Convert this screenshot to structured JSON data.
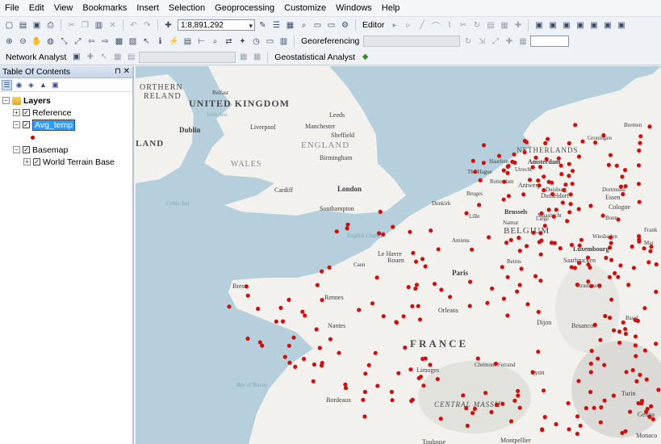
{
  "menu": [
    "File",
    "Edit",
    "View",
    "Bookmarks",
    "Insert",
    "Selection",
    "Geoprocessing",
    "Customize",
    "Windows",
    "Help"
  ],
  "toolbar": {
    "scale": "1:8,891,292",
    "editor_label": "Editor",
    "georeferencing_label": "Georeferencing",
    "network_analyst_label": "Network Analyst",
    "geostatistical_label": "Geostatistical Analyst"
  },
  "toc": {
    "title": "Table Of Contents",
    "pin_close": "⊓ ✕",
    "root_label": "Layers",
    "layers": [
      {
        "label": "Reference",
        "checked": true,
        "expanded": false
      },
      {
        "label": "Avg_temp",
        "checked": true,
        "expanded": true,
        "selected": true
      },
      {
        "label": "Basemap",
        "checked": true,
        "expanded": true
      },
      {
        "label": "World Terrain Base",
        "checked": true,
        "expanded": false
      }
    ]
  },
  "map": {
    "colors": {
      "sea": "#b5d0dc",
      "land": "#f2f1ee",
      "points": "#cc1111"
    },
    "labels": {
      "countries": [
        "UNITED KINGDOM",
        "ENGLAND",
        "WALES",
        "FRANCE",
        "BELGIUM",
        "NETHERLANDS",
        "CENTRAL MASSIF",
        "LAND",
        "ORTHERN",
        "RELAND"
      ],
      "cities": [
        "Belfast",
        "Leeds",
        "Dublin",
        "Liverpool",
        "Manchester",
        "Sheffield",
        "Birmingham",
        "Cardiff",
        "London",
        "Southampton",
        "Dunkirk",
        "Lille",
        "Amiens",
        "Le Havre",
        "Rouen",
        "Paris",
        "Reims",
        "Brest",
        "Rennes",
        "Nantes",
        "Orleans",
        "Dijon",
        "Besancon",
        "Limoges",
        "Clermont-Ferrand",
        "Lyon",
        "Bordeaux",
        "Toulouse",
        "Montpellier",
        "Monaco",
        "Turin",
        "Genoa",
        "Groningen",
        "Bremen",
        "Haarlem",
        "Amsterdam",
        "The Hague",
        "Utrecht",
        "Rotterdam",
        "Antwerp",
        "Brussels",
        "Namur",
        "Liege",
        "Maastricht",
        "Duisburg",
        "Dortmund",
        "Dusseldorf",
        "Essen",
        "Cologne",
        "Bonn",
        "Wiesbaden",
        "Luxembourg",
        "Saarbrucken",
        "Strasbourg",
        "Basel",
        "Mar",
        "Frank",
        "Bruges",
        "Caen"
      ],
      "seas": [
        "Irish Sea",
        "Celtic Sea",
        "English Channel",
        "Bay of Biscay"
      ]
    }
  }
}
